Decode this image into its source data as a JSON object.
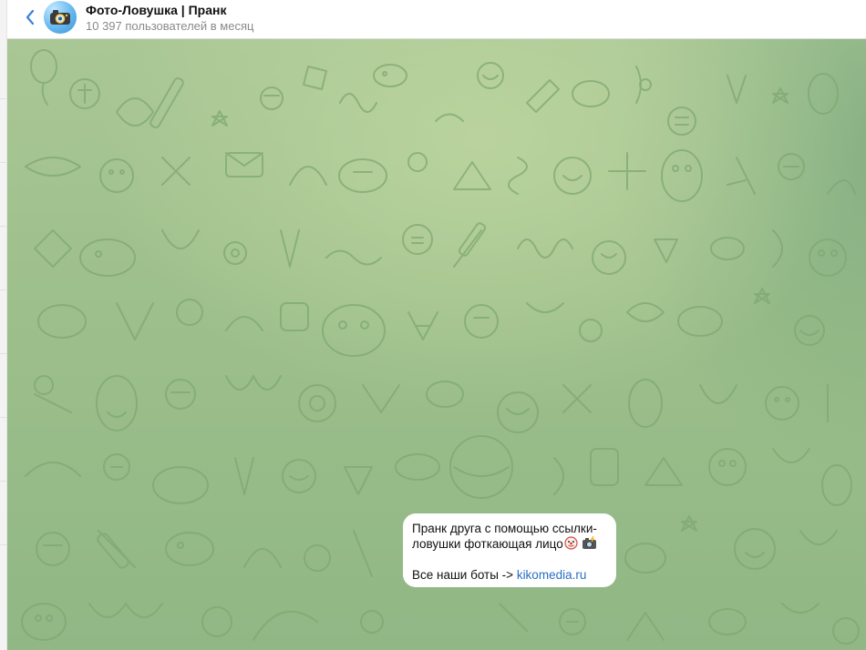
{
  "header": {
    "title": "Фото-Ловушка | Пранк",
    "subtitle": "10 397 пользователей в месяц"
  },
  "message": {
    "line1": "Пранк друга с помощью ссылки-",
    "line2": "ловушки фоткающая лицо",
    "line3_prefix": "Все наши боты -> ",
    "link_text": "kikomedia.ru"
  },
  "icons": {
    "back": "back-arrow-icon",
    "avatar": "camera-icon",
    "emoji1": "clown-face-emoji",
    "emoji2": "camera-flash-emoji"
  },
  "colors": {
    "accent": "#2b6fc5",
    "chat_background": "#9dbf8b",
    "bubble": "#ffffff"
  }
}
